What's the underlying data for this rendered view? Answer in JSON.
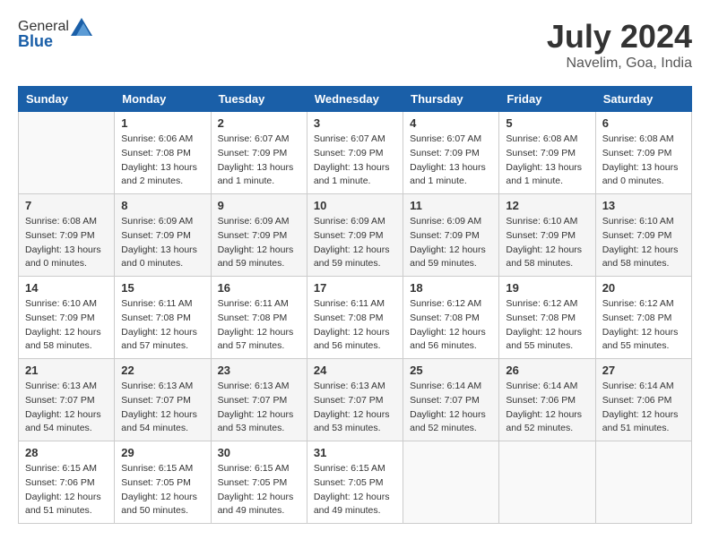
{
  "header": {
    "logo_general": "General",
    "logo_blue": "Blue",
    "month_title": "July 2024",
    "location": "Navelim, Goa, India"
  },
  "days_of_week": [
    "Sunday",
    "Monday",
    "Tuesday",
    "Wednesday",
    "Thursday",
    "Friday",
    "Saturday"
  ],
  "weeks": [
    [
      {
        "num": "",
        "sunrise": "",
        "sunset": "",
        "daylight": ""
      },
      {
        "num": "1",
        "sunrise": "Sunrise: 6:06 AM",
        "sunset": "Sunset: 7:08 PM",
        "daylight": "Daylight: 13 hours and 2 minutes."
      },
      {
        "num": "2",
        "sunrise": "Sunrise: 6:07 AM",
        "sunset": "Sunset: 7:09 PM",
        "daylight": "Daylight: 13 hours and 1 minute."
      },
      {
        "num": "3",
        "sunrise": "Sunrise: 6:07 AM",
        "sunset": "Sunset: 7:09 PM",
        "daylight": "Daylight: 13 hours and 1 minute."
      },
      {
        "num": "4",
        "sunrise": "Sunrise: 6:07 AM",
        "sunset": "Sunset: 7:09 PM",
        "daylight": "Daylight: 13 hours and 1 minute."
      },
      {
        "num": "5",
        "sunrise": "Sunrise: 6:08 AM",
        "sunset": "Sunset: 7:09 PM",
        "daylight": "Daylight: 13 hours and 1 minute."
      },
      {
        "num": "6",
        "sunrise": "Sunrise: 6:08 AM",
        "sunset": "Sunset: 7:09 PM",
        "daylight": "Daylight: 13 hours and 0 minutes."
      }
    ],
    [
      {
        "num": "7",
        "sunrise": "Sunrise: 6:08 AM",
        "sunset": "Sunset: 7:09 PM",
        "daylight": "Daylight: 13 hours and 0 minutes."
      },
      {
        "num": "8",
        "sunrise": "Sunrise: 6:09 AM",
        "sunset": "Sunset: 7:09 PM",
        "daylight": "Daylight: 13 hours and 0 minutes."
      },
      {
        "num": "9",
        "sunrise": "Sunrise: 6:09 AM",
        "sunset": "Sunset: 7:09 PM",
        "daylight": "Daylight: 12 hours and 59 minutes."
      },
      {
        "num": "10",
        "sunrise": "Sunrise: 6:09 AM",
        "sunset": "Sunset: 7:09 PM",
        "daylight": "Daylight: 12 hours and 59 minutes."
      },
      {
        "num": "11",
        "sunrise": "Sunrise: 6:09 AM",
        "sunset": "Sunset: 7:09 PM",
        "daylight": "Daylight: 12 hours and 59 minutes."
      },
      {
        "num": "12",
        "sunrise": "Sunrise: 6:10 AM",
        "sunset": "Sunset: 7:09 PM",
        "daylight": "Daylight: 12 hours and 58 minutes."
      },
      {
        "num": "13",
        "sunrise": "Sunrise: 6:10 AM",
        "sunset": "Sunset: 7:09 PM",
        "daylight": "Daylight: 12 hours and 58 minutes."
      }
    ],
    [
      {
        "num": "14",
        "sunrise": "Sunrise: 6:10 AM",
        "sunset": "Sunset: 7:09 PM",
        "daylight": "Daylight: 12 hours and 58 minutes."
      },
      {
        "num": "15",
        "sunrise": "Sunrise: 6:11 AM",
        "sunset": "Sunset: 7:08 PM",
        "daylight": "Daylight: 12 hours and 57 minutes."
      },
      {
        "num": "16",
        "sunrise": "Sunrise: 6:11 AM",
        "sunset": "Sunset: 7:08 PM",
        "daylight": "Daylight: 12 hours and 57 minutes."
      },
      {
        "num": "17",
        "sunrise": "Sunrise: 6:11 AM",
        "sunset": "Sunset: 7:08 PM",
        "daylight": "Daylight: 12 hours and 56 minutes."
      },
      {
        "num": "18",
        "sunrise": "Sunrise: 6:12 AM",
        "sunset": "Sunset: 7:08 PM",
        "daylight": "Daylight: 12 hours and 56 minutes."
      },
      {
        "num": "19",
        "sunrise": "Sunrise: 6:12 AM",
        "sunset": "Sunset: 7:08 PM",
        "daylight": "Daylight: 12 hours and 55 minutes."
      },
      {
        "num": "20",
        "sunrise": "Sunrise: 6:12 AM",
        "sunset": "Sunset: 7:08 PM",
        "daylight": "Daylight: 12 hours and 55 minutes."
      }
    ],
    [
      {
        "num": "21",
        "sunrise": "Sunrise: 6:13 AM",
        "sunset": "Sunset: 7:07 PM",
        "daylight": "Daylight: 12 hours and 54 minutes."
      },
      {
        "num": "22",
        "sunrise": "Sunrise: 6:13 AM",
        "sunset": "Sunset: 7:07 PM",
        "daylight": "Daylight: 12 hours and 54 minutes."
      },
      {
        "num": "23",
        "sunrise": "Sunrise: 6:13 AM",
        "sunset": "Sunset: 7:07 PM",
        "daylight": "Daylight: 12 hours and 53 minutes."
      },
      {
        "num": "24",
        "sunrise": "Sunrise: 6:13 AM",
        "sunset": "Sunset: 7:07 PM",
        "daylight": "Daylight: 12 hours and 53 minutes."
      },
      {
        "num": "25",
        "sunrise": "Sunrise: 6:14 AM",
        "sunset": "Sunset: 7:07 PM",
        "daylight": "Daylight: 12 hours and 52 minutes."
      },
      {
        "num": "26",
        "sunrise": "Sunrise: 6:14 AM",
        "sunset": "Sunset: 7:06 PM",
        "daylight": "Daylight: 12 hours and 52 minutes."
      },
      {
        "num": "27",
        "sunrise": "Sunrise: 6:14 AM",
        "sunset": "Sunset: 7:06 PM",
        "daylight": "Daylight: 12 hours and 51 minutes."
      }
    ],
    [
      {
        "num": "28",
        "sunrise": "Sunrise: 6:15 AM",
        "sunset": "Sunset: 7:06 PM",
        "daylight": "Daylight: 12 hours and 51 minutes."
      },
      {
        "num": "29",
        "sunrise": "Sunrise: 6:15 AM",
        "sunset": "Sunset: 7:05 PM",
        "daylight": "Daylight: 12 hours and 50 minutes."
      },
      {
        "num": "30",
        "sunrise": "Sunrise: 6:15 AM",
        "sunset": "Sunset: 7:05 PM",
        "daylight": "Daylight: 12 hours and 49 minutes."
      },
      {
        "num": "31",
        "sunrise": "Sunrise: 6:15 AM",
        "sunset": "Sunset: 7:05 PM",
        "daylight": "Daylight: 12 hours and 49 minutes."
      },
      {
        "num": "",
        "sunrise": "",
        "sunset": "",
        "daylight": ""
      },
      {
        "num": "",
        "sunrise": "",
        "sunset": "",
        "daylight": ""
      },
      {
        "num": "",
        "sunrise": "",
        "sunset": "",
        "daylight": ""
      }
    ]
  ]
}
